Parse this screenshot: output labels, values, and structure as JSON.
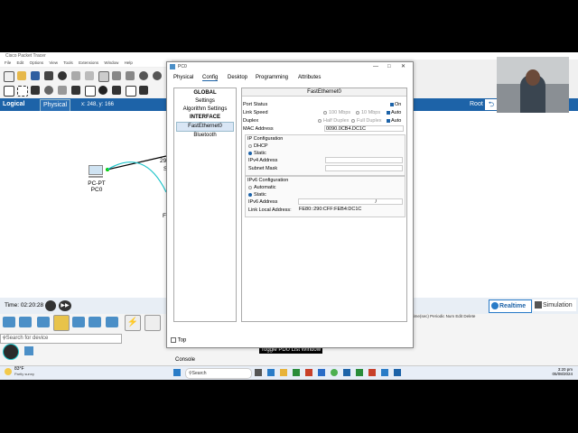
{
  "app": {
    "title": "Cisco Packet Tracer",
    "menu": [
      "File",
      "Edit",
      "Options",
      "View",
      "Tools",
      "Extensions",
      "Window",
      "Help"
    ]
  },
  "logical": {
    "logical_label": "Logical",
    "physical_label": "Physical",
    "coords": "x: 248, y: 166",
    "root_label": "Root"
  },
  "workspace": {
    "device_label_type": "PC-PT",
    "device_label_name": "PC0",
    "partial_label_1": "29",
    "partial_label_2": "S",
    "partial_label_3": "F"
  },
  "bottom": {
    "time": "Time: 02:20:28",
    "realtime": "Realtime",
    "simulation": "Simulation",
    "search_placeholder": "Search for device",
    "console": "Console",
    "toggle_pdu": "Toggle PDU List Window",
    "sim_cols": "Time(sec)  Periodic  Num  Edit  Delete"
  },
  "pc_window": {
    "title": "PC0",
    "tabs": [
      "Physical",
      "Config",
      "Desktop",
      "Programming",
      "Attributes"
    ],
    "left_panel": {
      "global": "GLOBAL",
      "settings": "Settings",
      "algorithm": "Algorithm Settings",
      "interface": "INTERFACE",
      "fastethernet": "FastEthernet0",
      "bluetooth": "Bluetooth"
    },
    "top_checkbox": "Top",
    "iface": {
      "title": "FastEthernet0",
      "port_status_label": "Port Status",
      "port_status_on": "On",
      "link_speed_label": "Link Speed",
      "speed_100": "100 Mbps",
      "speed_10": "10 Mbps",
      "speed_auto": "Auto",
      "duplex_label": "Duplex",
      "half_duplex": "Half Duplex",
      "full_duplex": "Full Duplex",
      "duplex_auto": "Auto",
      "mac_label": "MAC Address",
      "mac_value": "0090.0CB4.DC1C",
      "ip_config_title": "IP Configuration",
      "dhcp": "DHCP",
      "static": "Static",
      "ipv4_label": "IPv4 Address",
      "ipv4_value": "",
      "subnet_label": "Subnet Mask",
      "subnet_value": "",
      "ipv6_config_title": "IPv6 Configuration",
      "automatic": "Automatic",
      "static6": "Static",
      "ipv6_label": "IPv6 Address",
      "ipv6_value": "/",
      "link_local_label": "Link Local Address:",
      "link_local_value": "FE80::290:CFF:FEB4:DC1C"
    }
  },
  "taskbar": {
    "weather_temp": "83°F",
    "weather_desc": "Partly sunny",
    "search": "Search",
    "time": "3:20 pm",
    "date": "05/08/2024"
  },
  "colors": {
    "accent": "#1d63a8",
    "link_line": "#000000",
    "cable_teal": "#1cc3c9"
  }
}
